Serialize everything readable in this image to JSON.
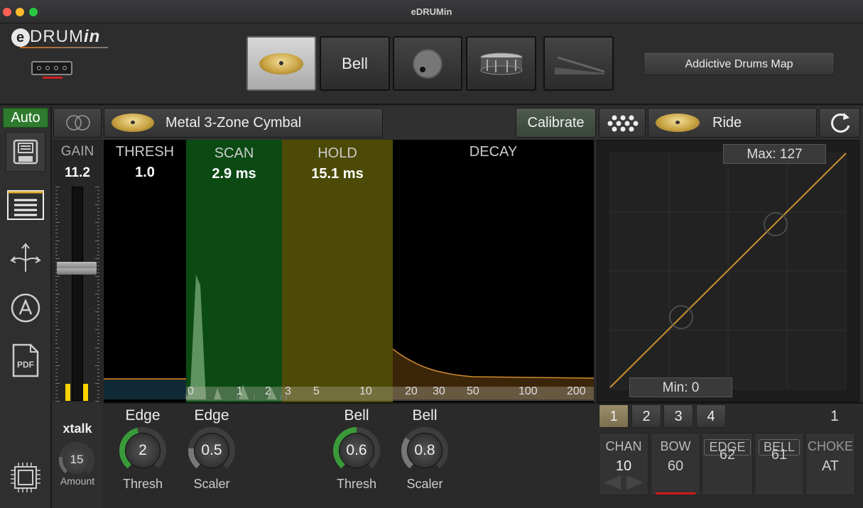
{
  "window": {
    "title": "eDRUMin"
  },
  "logo": {
    "e": "e",
    "drum": "DRUM",
    "in": "in"
  },
  "pad_selector": {
    "buttons": [
      {
        "name": "cymbal-bow",
        "label": "",
        "selected": true
      },
      {
        "name": "bell",
        "label": "Bell",
        "selected": false
      },
      {
        "name": "knob-control",
        "label": "",
        "selected": false
      },
      {
        "name": "snare",
        "label": "",
        "selected": false
      },
      {
        "name": "hihat-pedal",
        "label": "",
        "selected": false
      }
    ]
  },
  "map_button": {
    "label": "Addictive Drums Map"
  },
  "sidebar": {
    "auto_label": "Auto"
  },
  "pad_bar": {
    "pad_type": "Metal 3-Zone Cymbal",
    "calibrate": "Calibrate",
    "instrument": "Ride"
  },
  "gain": {
    "label": "GAIN",
    "value": "11.2",
    "level_pct": 62
  },
  "zones": {
    "thresh": {
      "label": "THRESH",
      "value": "1.0"
    },
    "scan": {
      "label": "SCAN",
      "value": "2.9 ms"
    },
    "hold": {
      "label": "HOLD",
      "value": "15.1 ms"
    },
    "decay": {
      "label": "DECAY"
    }
  },
  "time_ticks": [
    "0",
    "1",
    "2",
    "3",
    "5",
    "10",
    "20",
    "30",
    "50",
    "100",
    "200"
  ],
  "velocity_curve": {
    "max_label": "Max: 127",
    "min_label": "Min: 0"
  },
  "xtalk": {
    "label": "xtalk",
    "value": "15",
    "caption": "Amount"
  },
  "knobs": [
    {
      "top": "Edge",
      "value": "2",
      "bottom": "Thresh",
      "color": "#3a9a3a",
      "level": 0.45
    },
    {
      "top": "Edge",
      "value": "0.5",
      "bottom": "Scaler",
      "color": "#777777",
      "level": 0.2
    },
    {
      "top": "Bell",
      "value": "0.6",
      "bottom": "Thresh",
      "color": "#3a9a3a",
      "level": 0.5
    },
    {
      "top": "Bell",
      "value": "0.8",
      "bottom": "Scaler",
      "color": "#777777",
      "level": 0.3
    }
  ],
  "mapping": {
    "tabs": [
      "1",
      "2",
      "3",
      "4"
    ],
    "selected_tab": "1",
    "current": "1",
    "cells": [
      {
        "header": "CHAN",
        "value": "10"
      },
      {
        "header": "BOW",
        "value": "60"
      },
      {
        "header": "EDGE",
        "value": "62"
      },
      {
        "header": "BELL",
        "value": "61"
      },
      {
        "header": "CHOKE",
        "value": "AT"
      }
    ]
  }
}
